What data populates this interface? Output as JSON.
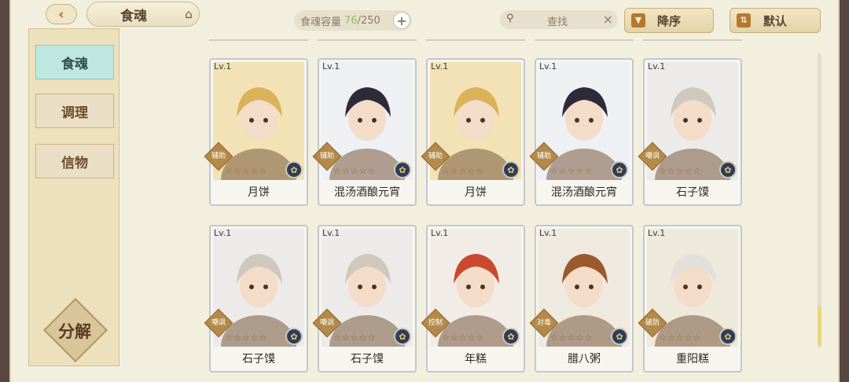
{
  "header": {
    "title": "食魂",
    "capacity_label": "食魂容量",
    "capacity_current": "76",
    "capacity_max": "/250",
    "search_placeholder": "查找",
    "sort_desc_label": "降序",
    "sort_default_label": "默认"
  },
  "sidebar": {
    "items": [
      {
        "label": "食魂"
      },
      {
        "label": "调理"
      },
      {
        "label": "信物"
      }
    ],
    "decompose_label": "分解"
  },
  "cards": [
    {
      "level": "Lv.1",
      "role": "辅助",
      "name": "月饼",
      "hair": "#d9b25a",
      "bg": "#f2e2b6"
    },
    {
      "level": "Lv.1",
      "role": "辅助",
      "name": "混汤酒酿元宵",
      "hair": "#2e2a3a",
      "bg": "#eef0f4"
    },
    {
      "level": "Lv.1",
      "role": "辅助",
      "name": "月饼",
      "hair": "#d9b25a",
      "bg": "#f2e2b6"
    },
    {
      "level": "Lv.1",
      "role": "辅助",
      "name": "混汤酒酿元宵",
      "hair": "#2e2a3a",
      "bg": "#eef0f4"
    },
    {
      "level": "Lv.1",
      "role": "嘲讽",
      "name": "石子馍",
      "hair": "#cfc9bd",
      "bg": "#ecebea"
    },
    {
      "level": "Lv.1",
      "role": "嘲讽",
      "name": "石子馍",
      "hair": "#cfc9bd",
      "bg": "#ecebea"
    },
    {
      "level": "Lv.1",
      "role": "嘲讽",
      "name": "石子馍",
      "hair": "#cfc9bd",
      "bg": "#ecebea"
    },
    {
      "level": "Lv.1",
      "role": "控制",
      "name": "年糕",
      "hair": "#c9492f",
      "bg": "#f1ece6"
    },
    {
      "level": "Lv.1",
      "role": "对毒",
      "name": "腊八粥",
      "hair": "#9a5a2e",
      "bg": "#efe9e0"
    },
    {
      "level": "Lv.1",
      "role": "破防",
      "name": "重阳糕",
      "hair": "#e2e0dc",
      "bg": "#eee9da"
    }
  ],
  "colors": {
    "active_tab": "#bfe7e0",
    "card_border": "#c2c6cf",
    "capacity_current": "#8fbf5a"
  }
}
